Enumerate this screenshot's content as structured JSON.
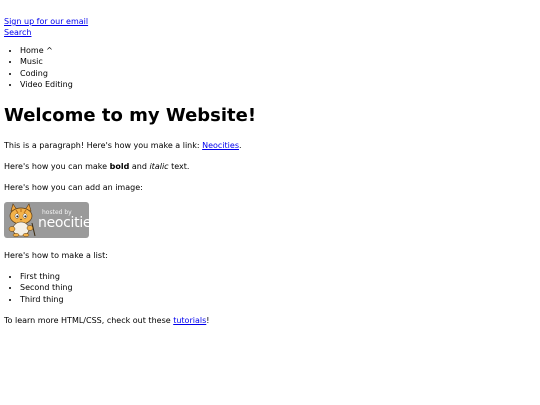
{
  "top_links": {
    "signup": "Sign up for our email",
    "search": "Search"
  },
  "nav": {
    "items": [
      {
        "label": "Home ^"
      },
      {
        "label": "Music"
      },
      {
        "label": "Coding"
      },
      {
        "label": "Video Editing"
      }
    ]
  },
  "main": {
    "heading": "Welcome to my Website!",
    "intro_text": "This is a paragraph! Here's how you make a link: ",
    "intro_link": "Neocities",
    "intro_end": ".",
    "bold_pre": "Here's how you can make ",
    "bold_word": "bold",
    "bold_mid": " and ",
    "italic_word": "italic",
    "bold_post": " text.",
    "image_text": "Here's how you can add an image:",
    "badge": {
      "small_text": "hosted by",
      "big_text": "neocities",
      "bg_color": "#9a9a9a"
    },
    "list_text": "Here's how to make a list:",
    "list_items": [
      {
        "label": "First thing"
      },
      {
        "label": "Second thing"
      },
      {
        "label": "Third thing"
      }
    ],
    "learn_pre": "To learn more HTML/CSS, check out these ",
    "learn_link": "tutorials",
    "learn_post": "!"
  },
  "colors": {
    "link": "#0000ee",
    "text": "#000000",
    "background": "#ffffff"
  }
}
